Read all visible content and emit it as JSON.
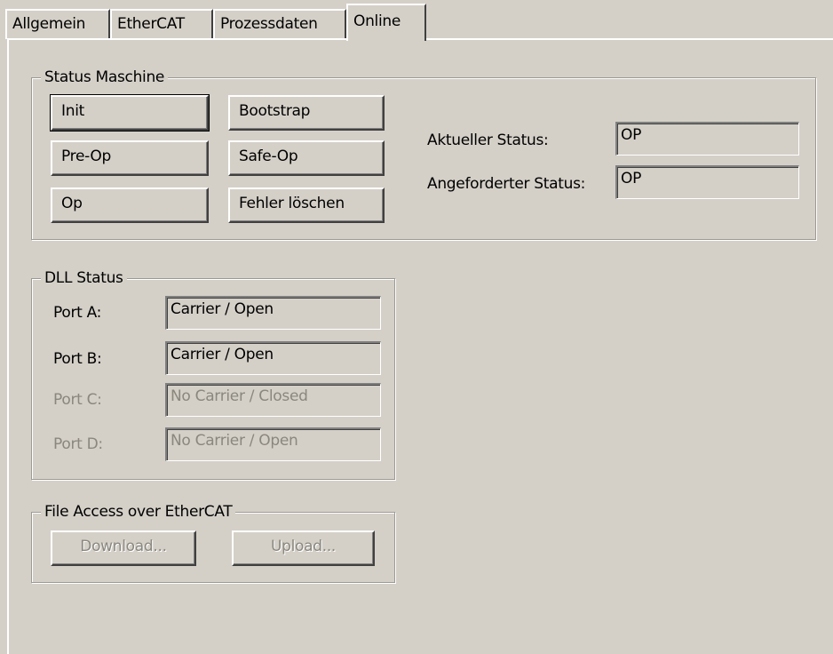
{
  "tabs": [
    {
      "label": "Allgemein",
      "active": false
    },
    {
      "label": "EtherCAT",
      "active": false
    },
    {
      "label": "Prozessdaten",
      "active": false
    },
    {
      "label": "Online",
      "active": true
    }
  ],
  "status_machine": {
    "title": "Status Maschine",
    "buttons": {
      "init": "Init",
      "bootstrap": "Bootstrap",
      "pre_op": "Pre-Op",
      "safe_op": "Safe-Op",
      "op": "Op",
      "clear_errors": "Fehler löschen"
    },
    "current_status_label": "Aktueller Status:",
    "current_status_value": "OP",
    "requested_status_label": "Angeforderter Status:",
    "requested_status_value": "OP"
  },
  "dll_status": {
    "title": "DLL Status",
    "ports": [
      {
        "label": "Port A:",
        "value": "Carrier / Open",
        "enabled": true
      },
      {
        "label": "Port B:",
        "value": "Carrier / Open",
        "enabled": true
      },
      {
        "label": "Port C:",
        "value": "No Carrier / Closed",
        "enabled": false
      },
      {
        "label": "Port D:",
        "value": "No Carrier / Open",
        "enabled": false
      }
    ]
  },
  "file_access": {
    "title": "File Access over EtherCAT",
    "download_label": "Download...",
    "upload_label": "Upload..."
  },
  "colors": {
    "background": "#d4d0c8",
    "disabled_text": "#8a877f"
  }
}
